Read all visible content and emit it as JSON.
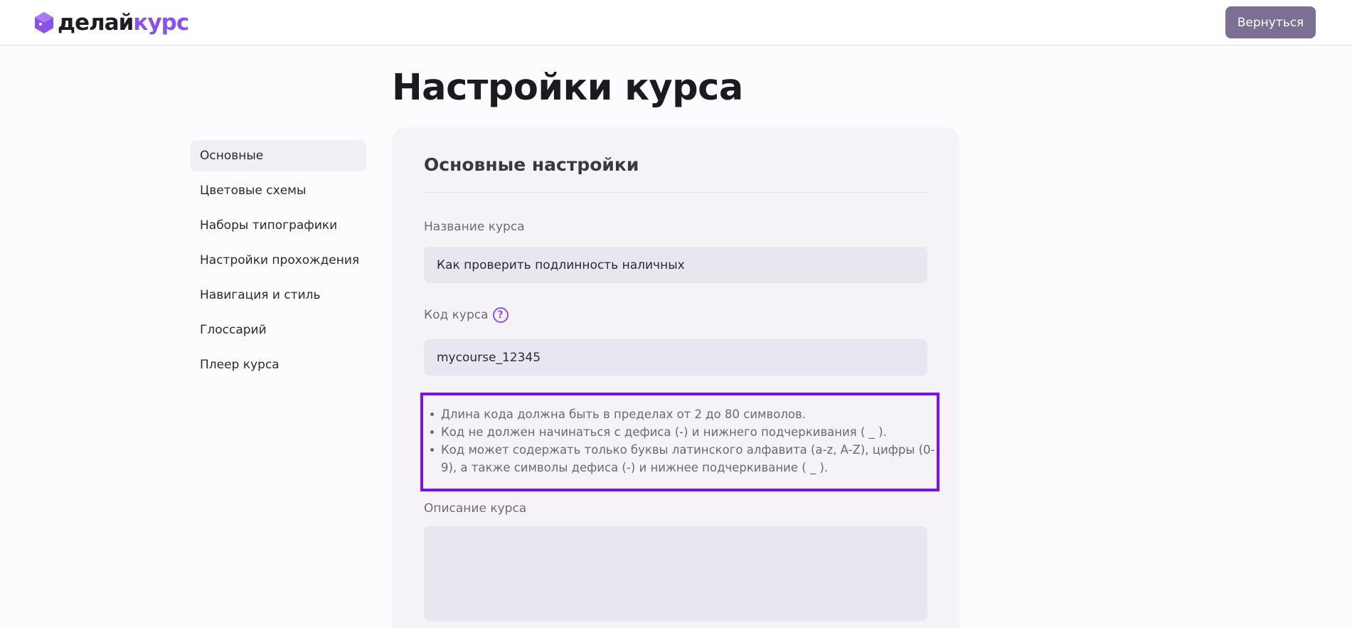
{
  "header": {
    "logo_part1": "делай",
    "logo_part2": "курс",
    "back_button": "Вернуться"
  },
  "page_title": "Настройки курса",
  "sidebar": {
    "items": [
      {
        "label": "Основные",
        "active": true
      },
      {
        "label": "Цветовые схемы",
        "active": false
      },
      {
        "label": "Наборы типографики",
        "active": false
      },
      {
        "label": "Настройки прохождения",
        "active": false
      },
      {
        "label": "Навигация и стиль",
        "active": false
      },
      {
        "label": "Глоссарий",
        "active": false
      },
      {
        "label": "Плеер курса",
        "active": false
      }
    ]
  },
  "card": {
    "title": "Основные настройки",
    "course_name_label": "Название курса",
    "course_name_value": "Как проверить подлинность наличных",
    "course_code_label": "Код курса",
    "course_code_value": "mycourse_12345",
    "help_icon": "?",
    "hints": [
      "Длина кода должна быть в пределах от 2 до 80 символов.",
      "Код не должен начинаться с дефиса (-) и нижнего подчеркивания ( _ ).",
      "Код может содержать только буквы латинского алфавита (a-z, A-Z), цифры (0-9), а также символы дефиса (-) и нижнее подчеркивание ( _ )."
    ],
    "description_label": "Описание курса",
    "description_value": ""
  },
  "colors": {
    "accent": "#8b52e8",
    "highlight_border": "#7a10f0",
    "button_bg": "#7d6f93"
  }
}
